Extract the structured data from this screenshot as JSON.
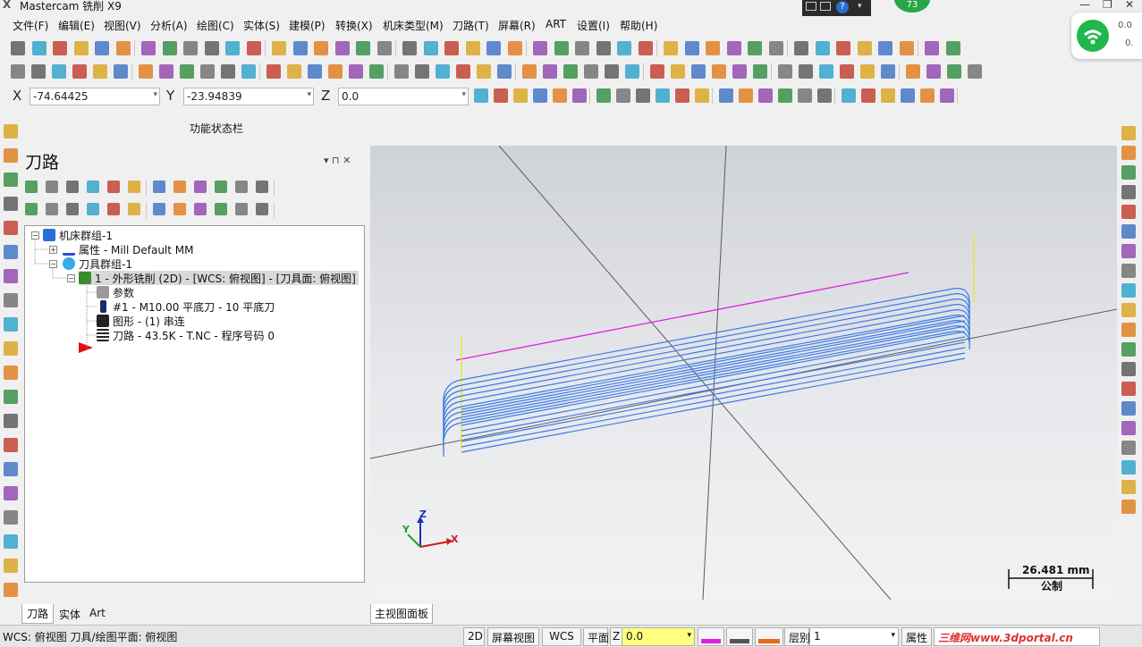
{
  "app": {
    "title": "Mastercam 铣削 X9"
  },
  "notify_badge": "73",
  "wifi": {
    "speed1": "0.0",
    "speed2": "0."
  },
  "menu": [
    "文件(F)",
    "编辑(E)",
    "视图(V)",
    "分析(A)",
    "绘图(C)",
    "实体(S)",
    "建模(P)",
    "转换(X)",
    "机床类型(M)",
    "刀路(T)",
    "屏幕(R)",
    "ART",
    "设置(I)",
    "帮助(H)"
  ],
  "coords": {
    "x_label": "X",
    "x_value": "-74.64425",
    "y_label": "Y",
    "y_value": "-23.94839",
    "z_label": "Z",
    "z_value": "0.0"
  },
  "function_status": "功能状态栏",
  "panel": {
    "title": "刀路",
    "pin": "▾ ⊓ ✕",
    "tree": [
      {
        "label": "机床群组-1"
      },
      {
        "label": "属性 - Mill Default MM"
      },
      {
        "label": "刀具群组-1"
      },
      {
        "label": "1 - 外形铣削 (2D) - [WCS: 俯视图] - [刀具面: 俯视图]"
      },
      {
        "label": "参数"
      },
      {
        "label": "#1 - M10.00 平底刀 - 10 平底刀"
      },
      {
        "label": "图形 - (1) 串连"
      },
      {
        "label": "刀路 - 43.5K - T.NC - 程序号码 0"
      }
    ],
    "tabs": [
      "刀路",
      "实体",
      "Art"
    ]
  },
  "viewport": {
    "tab": "主视图面板",
    "scale_value": "26.481 mm",
    "scale_unit": "公制",
    "axis_x": "X",
    "axis_y": "Y",
    "axis_z": "Z"
  },
  "status": {
    "info": "WCS: 俯视图  刀具/绘图平面: 俯视图",
    "mode2d": "2D",
    "screen_view": "屏幕视图",
    "wcs": "WCS",
    "plane": "平面",
    "z_label": "Z",
    "z_value": "0.0",
    "level_label": "层别",
    "level_value": "1",
    "attr": "属性",
    "watermark": "三维网www.3dportal.cn"
  },
  "colors": {
    "toolpath": "#3b7be8",
    "chain": "#e020e0",
    "leadline": "#e8e820",
    "zfield": "#ffff80"
  }
}
